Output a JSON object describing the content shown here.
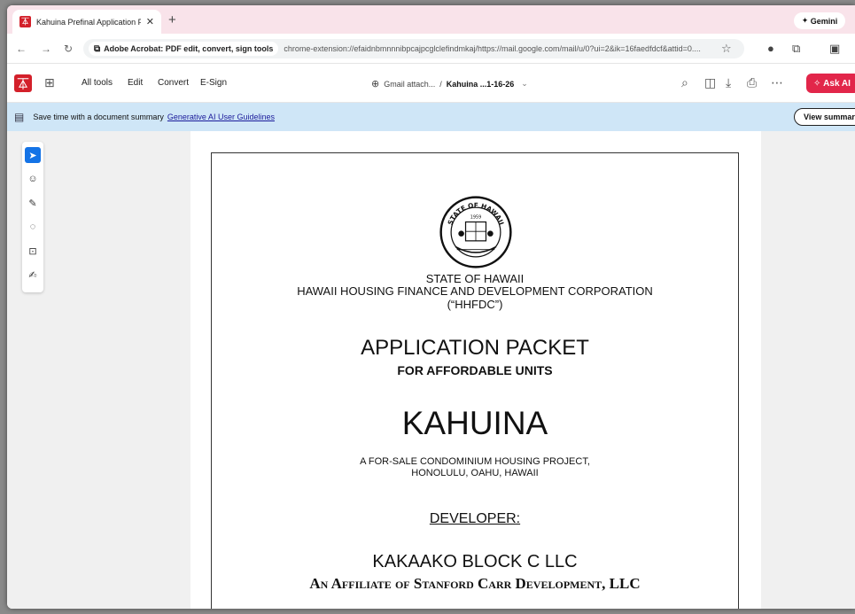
{
  "browser": {
    "tab_title": "Kahuina Prefinal Application Pa...",
    "tab_close": "✕",
    "new_tab": "+",
    "gemini_label": "Gemini",
    "ext_chip": "Adobe Acrobat: PDF edit, convert, sign tools",
    "url": "chrome-extension://efaidnbmnnnibpcajpcglclefindmkaj/https://mail.google.com/mail/u/0?ui=2&ik=16faedfdcf&attid=0...."
  },
  "acrobat": {
    "menu": [
      "All tools",
      "Edit",
      "Convert",
      "E-Sign"
    ],
    "breadcrumb_parent": "Gmail attach...",
    "breadcrumb_sep": "/",
    "breadcrumb_current": "Kahuina ...1-16-26",
    "ask_ai": "Ask AI",
    "brand_color": "#d3202a"
  },
  "banner": {
    "text": "Save time with a document summary",
    "link": "Generative AI User Guidelines",
    "button": "View summary"
  },
  "document": {
    "state": "STATE OF HAWAII",
    "corporation": "HAWAII  HOUSING FINANCE AND DEVELOPMENT CORPORATION",
    "abbrev": "(“HHFDC”)",
    "packet_title": "APPLICATION PACKET",
    "packet_sub": "FOR AFFORDABLE UNITS",
    "project": "KAHUINA",
    "desc_line1": "A FOR-SALE CONDOMINIUM HOUSING PROJECT,",
    "desc_line2": "HONOLULU, OAHU, HAWAII",
    "developer_label": "DEVELOPER:",
    "developer": "KAKAAKO BLOCK C LLC",
    "affiliate": "An Affiliate of Stanford Carr Development, LLC",
    "seal_text_top": "STATE OF HAWAII",
    "seal_year": "1959"
  }
}
